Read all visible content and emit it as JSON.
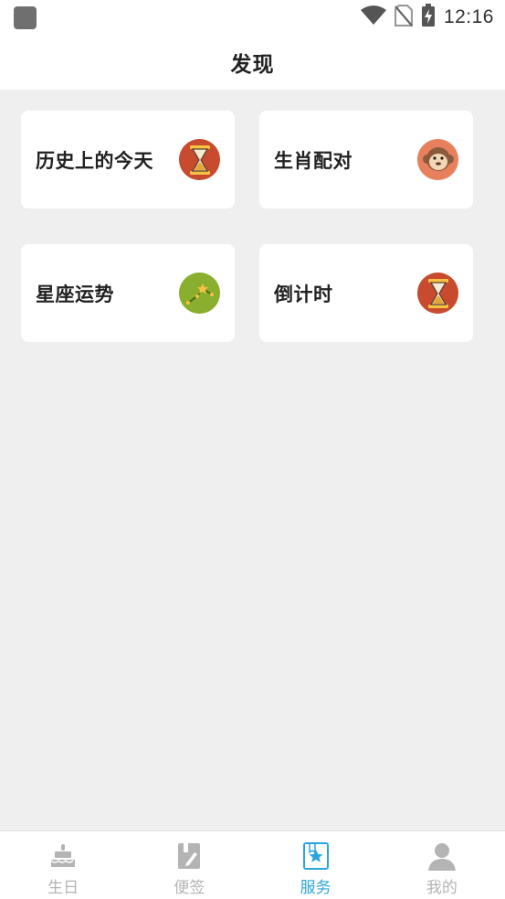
{
  "status_bar": {
    "time": "12:16",
    "icons": [
      "app-icon",
      "wifi-icon",
      "no-sim-icon",
      "battery-charging-icon"
    ]
  },
  "header": {
    "title": "发现"
  },
  "cards": [
    {
      "label": "历史上的今天",
      "icon": "hourglass-icon",
      "icon_bg": "#c84b2f"
    },
    {
      "label": "生肖配对",
      "icon": "monkey-icon",
      "icon_bg": "#e8805e"
    },
    {
      "label": "星座运势",
      "icon": "constellation-icon",
      "icon_bg": "#8aaf2e"
    },
    {
      "label": "倒计时",
      "icon": "hourglass-icon",
      "icon_bg": "#c84b2f"
    }
  ],
  "bottom_nav": {
    "active_color": "#2ba6dd",
    "inactive_color": "#b4b4b4",
    "items": [
      {
        "label": "生日",
        "icon": "cake-icon",
        "active": false
      },
      {
        "label": "便签",
        "icon": "notepad-icon",
        "active": false
      },
      {
        "label": "服务",
        "icon": "star-bookmark-icon",
        "active": true
      },
      {
        "label": "我的",
        "icon": "person-icon",
        "active": false
      }
    ]
  }
}
